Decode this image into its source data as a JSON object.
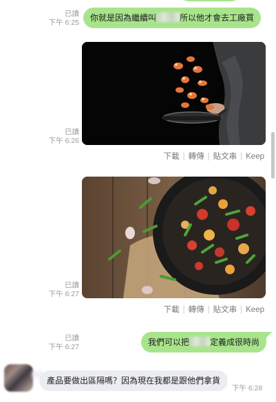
{
  "messages": [
    {
      "read_label": "已讀",
      "time": "下午 6:25",
      "text_before": "你就是因為繼續叫",
      "text_after": "所以他才會去工廠買"
    },
    {
      "read_label": "已讀",
      "time": "下午 6:26"
    },
    {
      "read_label": "已讀",
      "time": "下午 6:27"
    },
    {
      "read_label": "已讀",
      "time": "下午 6:27",
      "text_before": "我們可以把",
      "text_after": "定義成很時尚"
    }
  ],
  "incoming": {
    "text": "產品要做出區隔嗎？因為現在我都是跟他們拿貨",
    "time": "下午 6:28"
  },
  "image_actions": {
    "download": "下載",
    "forward": "轉傳",
    "post": "貼文串",
    "keep": "Keep"
  },
  "colors": {
    "outgoing_bubble": "#a8e48c",
    "incoming_bubble": "#ecedf0",
    "meta_text": "#9a9a9a"
  }
}
